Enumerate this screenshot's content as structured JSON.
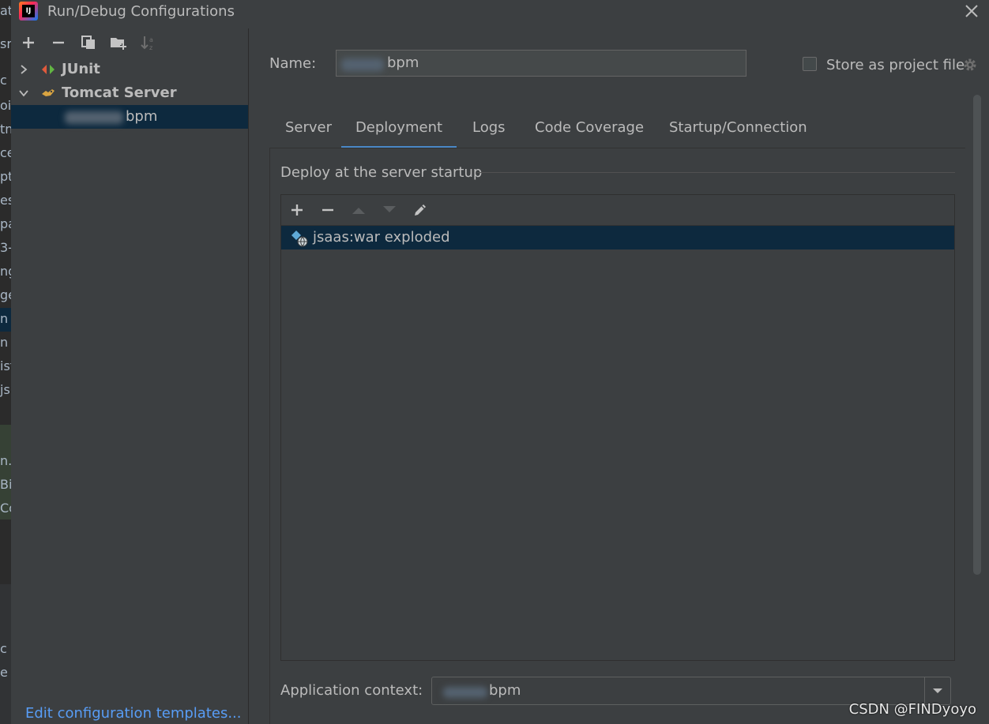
{
  "window": {
    "title": "Run/Debug Configurations"
  },
  "ide_fragments": [
    "at",
    "sr",
    "c",
    "oi",
    "tn",
    "ce",
    "pt",
    "es",
    "pa",
    "3-",
    "ng",
    "ge",
    "n",
    "n",
    "ist",
    "js",
    "n.r",
    "Bi",
    "Co",
    "c",
    "e"
  ],
  "tree": {
    "items": [
      {
        "label": "JUnit",
        "expanded": false
      },
      {
        "label": "Tomcat Server",
        "expanded": true
      },
      {
        "label": "bpm",
        "selected": true
      }
    ]
  },
  "edit_templates_link": "Edit configuration templates...",
  "name_field": {
    "label": "Name:",
    "value": "bpm"
  },
  "store_as_project_file": {
    "label": "Store as project file",
    "checked": false
  },
  "tabs": [
    "Server",
    "Deployment",
    "Logs",
    "Code Coverage",
    "Startup/Connection"
  ],
  "active_tab": "Deployment",
  "deploy_section": {
    "title": "Deploy at the server startup",
    "items": [
      "jsaas:war exploded"
    ]
  },
  "app_context": {
    "label": "Application context:",
    "value": "bpm"
  },
  "watermark": "CSDN @FINDyoyo",
  "colors": {
    "background": "#3c3f41",
    "selection": "#0d293e",
    "link": "#589df6",
    "tab_underline": "#4a88c7"
  },
  "icons": [
    "app-logo-icon",
    "close-icon",
    "add-icon",
    "remove-icon",
    "copy-icon",
    "folder-add-icon",
    "sort-icon",
    "chevron-right-icon",
    "chevron-down-icon",
    "junit-icon",
    "tomcat-icon",
    "gear-icon",
    "arrow-up-icon",
    "arrow-down-icon",
    "edit-icon",
    "artifact-icon",
    "dropdown-arrow-icon"
  ]
}
